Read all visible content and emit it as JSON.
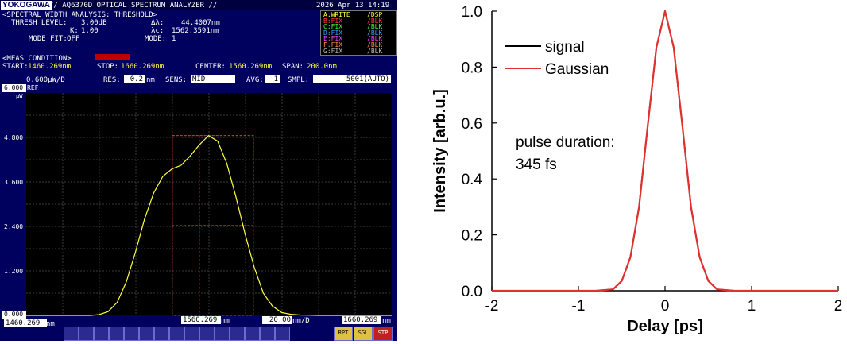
{
  "osa": {
    "brand": "YOKOGAWA",
    "title": "// AQ6370D OPTICAL SPECTRUM ANALYZER //",
    "datetime": "2026 Apr 13 14:19",
    "analysis_header": "<SPECTRAL WIDTH ANALYSIS: THRESHOLD>",
    "thresh_label": "THRESH LEVEL:",
    "thresh_value": "3.00dB",
    "k_label": "K:",
    "k_value": "1.00",
    "modefit_label": "MODE FIT:",
    "modefit_value": "OFF",
    "dl_label": "Δλ:",
    "dl_value": "44.4007nm",
    "lc_label": "λc:",
    "lc_value": "1562.3591nm",
    "mode_label": "MODE:",
    "mode_value": "1",
    "traces": [
      {
        "name": "A:WRITE",
        "status": "/DSP",
        "color": "#ffff40"
      },
      {
        "name": "B:FIX",
        "status": "/BLK",
        "color": "#ff4040"
      },
      {
        "name": "C:FIX",
        "status": "/BLK",
        "color": "#40ff40"
      },
      {
        "name": "D:FIX",
        "status": "/BLK",
        "color": "#40a0ff"
      },
      {
        "name": "E:FIX",
        "status": "/BLK",
        "color": "#ff40ff"
      },
      {
        "name": "F:FIX",
        "status": "/BLK",
        "color": "#ff9040"
      },
      {
        "name": "G:FIX",
        "status": "/BLK",
        "color": "#c0c0c0"
      }
    ],
    "meas_condition": "<MEAS CONDITION>",
    "start_label": "START:",
    "start_value": "1460.269nm",
    "stop_label": "STOP:",
    "stop_value": "1660.269nm",
    "center_label": "CENTER:",
    "center_value": "1560.269nm",
    "span_label": "SPAN:",
    "span_value": "200.0nm",
    "scale_label": "0.600µW/D",
    "res_label": "RES:",
    "res_value": "0.2",
    "res_unit": "nm",
    "sens_label": "SENS:",
    "sens_value": "MID",
    "avg_label": "AVG:",
    "avg_value": "1",
    "smpl_label": "SMPL:",
    "smpl_value": "5001(AUTO)",
    "ref_top": "6.000",
    "ref_unit": "µW",
    "ref_label": "REF",
    "y_ticks": [
      "4.800",
      "3.600",
      "2.400",
      "1.200",
      "0.000"
    ],
    "x_left": "1460.269",
    "x_left_unit": "nm",
    "x_center": "1560.269",
    "x_center_unit": "nm",
    "x_step": "20.00",
    "x_step_unit": "nm/D",
    "x_right": "1660.269",
    "x_right_unit": "nm",
    "softkeys": [
      "RPT",
      "SGL",
      "STP"
    ],
    "spectrum": {
      "x_nm": [
        1460.27,
        1495,
        1500,
        1505,
        1510,
        1515,
        1520,
        1525,
        1530,
        1535,
        1540,
        1545,
        1550,
        1555,
        1560,
        1565,
        1570,
        1575,
        1580,
        1585,
        1590,
        1595,
        1600,
        1605,
        1610,
        1620,
        1660.27
      ],
      "y_uW": [
        0.0,
        0.0,
        0.02,
        0.1,
        0.35,
        0.9,
        1.7,
        2.6,
        3.3,
        3.75,
        3.95,
        4.05,
        4.3,
        4.6,
        4.85,
        4.7,
        4.1,
        3.2,
        2.2,
        1.3,
        0.6,
        0.25,
        0.08,
        0.03,
        0.01,
        0.0,
        0.0
      ]
    }
  },
  "chart_data": {
    "type": "line",
    "title": "",
    "xlabel": "Delay [ps]",
    "ylabel": "Intensity [arb.u.]",
    "xlim": [
      -2,
      2
    ],
    "ylim": [
      0,
      1.0
    ],
    "x_ticks": [
      "-2",
      "-1",
      "0",
      "1",
      "2"
    ],
    "y_ticks": [
      "0.0",
      "0.2",
      "0.4",
      "0.6",
      "0.8",
      "1.0"
    ],
    "legend": "top-left",
    "annotation": [
      "pulse duration:",
      "345 fs"
    ],
    "series": [
      {
        "name": "signal",
        "color": "#000000",
        "x": [
          -2,
          -1.5,
          -1,
          -0.8,
          -0.6,
          -0.5,
          -0.4,
          -0.3,
          -0.2,
          -0.1,
          0,
          0.1,
          0.2,
          0.3,
          0.4,
          0.5,
          0.6,
          0.8,
          1,
          1.5,
          2
        ],
        "y": [
          0,
          0,
          0,
          0,
          0.005,
          0.035,
          0.12,
          0.3,
          0.59,
          0.87,
          1.0,
          0.87,
          0.59,
          0.3,
          0.12,
          0.035,
          0.005,
          0,
          0,
          0,
          0
        ]
      },
      {
        "name": "Gaussian",
        "color": "#e03030",
        "x": [
          -2,
          -1.5,
          -1,
          -0.8,
          -0.6,
          -0.5,
          -0.4,
          -0.3,
          -0.2,
          -0.1,
          0,
          0.1,
          0.2,
          0.3,
          0.4,
          0.5,
          0.6,
          0.8,
          1,
          1.5,
          2
        ],
        "y": [
          0,
          0,
          0,
          0,
          0.005,
          0.035,
          0.12,
          0.3,
          0.59,
          0.87,
          1.0,
          0.87,
          0.59,
          0.3,
          0.12,
          0.035,
          0.005,
          0,
          0,
          0,
          0
        ]
      }
    ]
  }
}
